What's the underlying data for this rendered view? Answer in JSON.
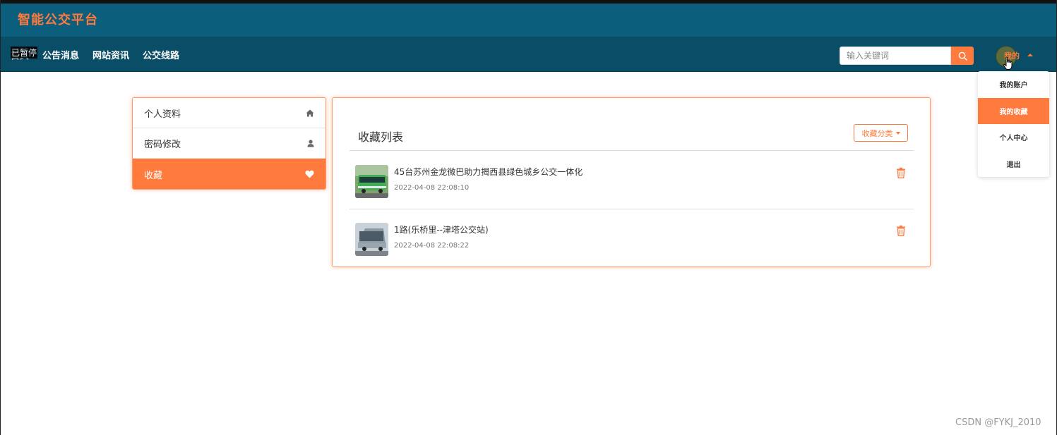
{
  "header": {
    "logo": "智能公交平台",
    "paused_label": "已暂停",
    "nav": [
      "首页",
      "公告消息",
      "网站资讯",
      "公交线路"
    ],
    "search": {
      "placeholder": "输入关键词"
    },
    "user_label": "我的"
  },
  "dropdown": {
    "items": [
      "我的账户",
      "我的收藏",
      "个人中心",
      "退出"
    ],
    "active_index": 1
  },
  "sidebar": {
    "items": [
      {
        "label": "个人资料",
        "icon": "home-icon"
      },
      {
        "label": "密码修改",
        "icon": "user-icon"
      },
      {
        "label": "收藏",
        "icon": "heart-icon"
      }
    ],
    "active_index": 2
  },
  "favorites": {
    "title": "收藏列表",
    "category_button": "收藏分类",
    "items": [
      {
        "title": "45台苏州金龙微巴助力揭西县绿色城乡公交一体化",
        "time": "2022-04-08 22:08:10"
      },
      {
        "title": "1路(乐桥里--津塔公交站)",
        "time": "2022-04-08 22:08:22"
      }
    ]
  },
  "watermark": "CSDN @FYKJ_2010",
  "colors": {
    "accent": "#ff7a3d",
    "topbar": "#0b5f7d",
    "navbar": "#0a4d66"
  }
}
